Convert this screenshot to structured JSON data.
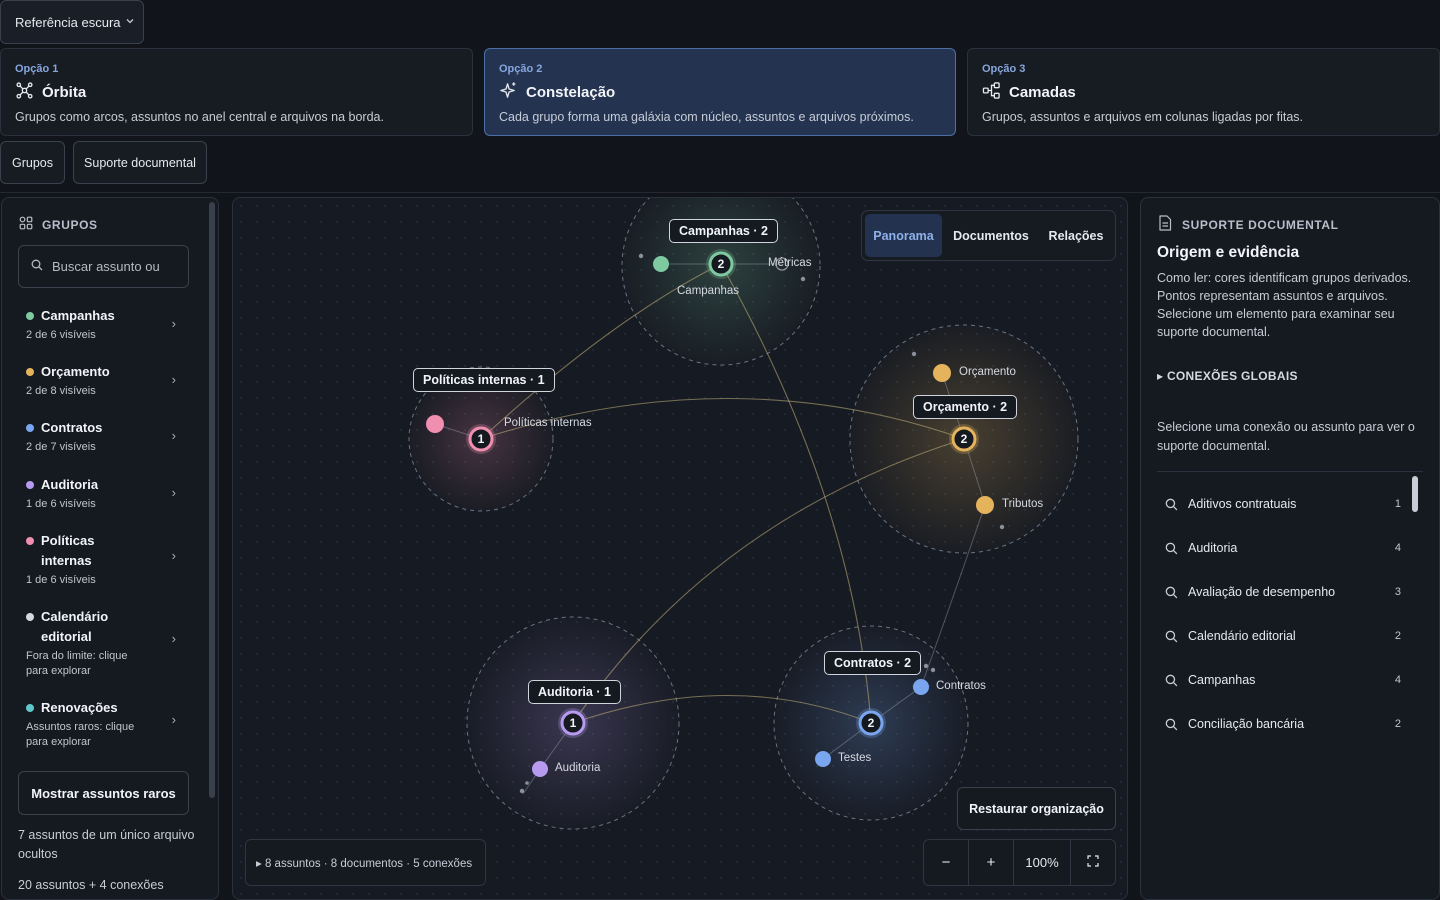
{
  "reference_select": {
    "label": "Referência escura"
  },
  "options": [
    {
      "kicker": "Opção 1",
      "title": "Órbita",
      "description": "Grupos como arcos, assuntos no anel central e arquivos na borda.",
      "icon": "orbit-icon"
    },
    {
      "kicker": "Opção 2",
      "title": "Constelação",
      "description": "Cada grupo forma uma galáxia com núcleo, assuntos e arquivos próximos.",
      "icon": "sparkle-icon"
    },
    {
      "kicker": "Opção 3",
      "title": "Camadas",
      "description": "Grupos, assuntos e arquivos em colunas ligadas por fitas.",
      "icon": "layers-icon"
    }
  ],
  "view_tabs": {
    "groups": "Grupos",
    "support": "Suporte documental"
  },
  "sidebar": {
    "header": "GRUPOS",
    "search_placeholder": "Buscar assunto ou",
    "groups": [
      {
        "name": "Campanhas",
        "sub": "2 de 6 visíveis",
        "color": "#7ec9a0"
      },
      {
        "name": "Orçamento",
        "sub": "2 de 8 visíveis",
        "color": "#e5b35c"
      },
      {
        "name": "Contratos",
        "sub": "2 de 7 visíveis",
        "color": "#7aa6f0"
      },
      {
        "name": "Auditoria",
        "sub": "1 de 6 visíveis",
        "color": "#b79af0"
      },
      {
        "name": "Políticas internas",
        "sub": "1 de 6 visíveis",
        "color": "#f08fb0"
      },
      {
        "name": "Calendário editorial",
        "sub": "Fora do limite: clique para explorar",
        "color": "#d4d8e0"
      },
      {
        "name": "Renovações",
        "sub": "Assuntos raros: clique para explorar",
        "color": "#5fc7c9"
      }
    ],
    "rare_button": "Mostrar assuntos raros",
    "hidden_note": "7 assuntos de um único arquivo ocultos",
    "extra_note": "20 assuntos + 4 conexões"
  },
  "canvas": {
    "segment": {
      "panorama": "Panorama",
      "documents": "Documentos",
      "relations": "Relações",
      "active": "Panorama"
    },
    "clusters": [
      {
        "label": "Campanhas · 2",
        "count": "2",
        "topics": [
          "Campanhas",
          "Métricas"
        ],
        "color": "#7ec9a0"
      },
      {
        "label": "Políticas internas · 1",
        "count": "1",
        "topics": [
          "Políticas internas"
        ],
        "color": "#f08fb0"
      },
      {
        "label": "Orçamento · 2",
        "count": "2",
        "topics": [
          "Orçamento",
          "Tributos"
        ],
        "color": "#e5b35c"
      },
      {
        "label": "Auditoria · 1",
        "count": "1",
        "topics": [
          "Auditoria"
        ],
        "color": "#b79af0"
      },
      {
        "label": "Contratos · 2",
        "count": "2",
        "topics": [
          "Contratos",
          "Testes"
        ],
        "color": "#7aa6f0"
      }
    ],
    "restore_button": "Restaurar organização",
    "stats": "▸ 8 assuntos · 8 documentos · 5 conexões",
    "zoom": {
      "minus": "−",
      "plus": "+",
      "value": "100%"
    }
  },
  "right_panel": {
    "header": "SUPORTE DOCUMENTAL",
    "title": "Origem e evidência",
    "description": "Como ler: cores identificam grupos derivados. Pontos representam assuntos e arquivos. Selecione um elemento para examinar seu suporte documental.",
    "global_connections": "▸ CONEXÕES GLOBAIS",
    "hint": "Selecione uma conexão ou assunto para ver o suporte documental.",
    "topics": [
      {
        "name": "Aditivos contratuais",
        "count": "1"
      },
      {
        "name": "Auditoria",
        "count": "4"
      },
      {
        "name": "Avaliação de desempenho",
        "count": "3"
      },
      {
        "name": "Calendário editorial",
        "count": "2"
      },
      {
        "name": "Campanhas",
        "count": "4"
      },
      {
        "name": "Conciliação bancária",
        "count": "2"
      }
    ]
  }
}
